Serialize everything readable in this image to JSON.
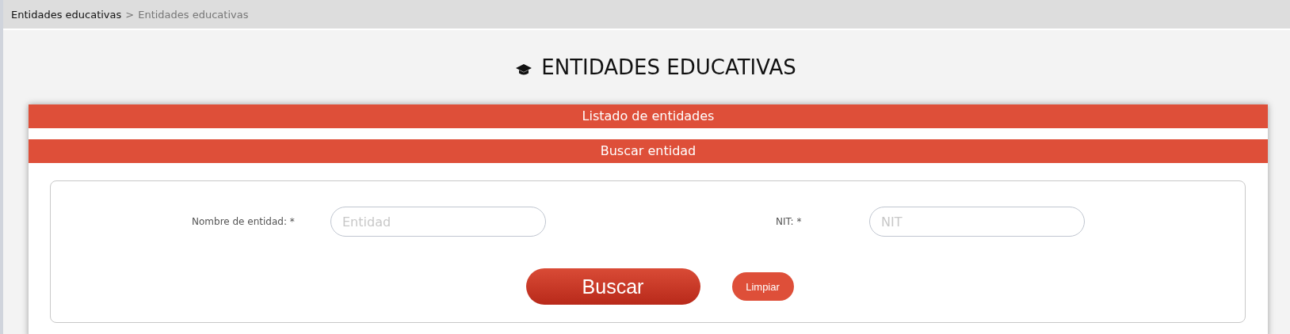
{
  "breadcrumb": [
    {
      "label": "Entidades educativas",
      "current": false
    },
    {
      "label": "Entidades educativas",
      "current": true
    }
  ],
  "breadcrumb_separator": ">",
  "page_title": "ENTIDADES EDUCATIVAS",
  "sections": [
    "Listado de entidades",
    "Buscar entidad"
  ],
  "fields": [
    {
      "label": "Nombre de entidad: *",
      "placeholder": "Entidad"
    },
    {
      "label": "NIT: *",
      "placeholder": "NIT"
    }
  ],
  "buttons": [
    {
      "label": "Buscar",
      "kind": "primary"
    },
    {
      "label": "Limpiar",
      "kind": "secondary"
    }
  ]
}
